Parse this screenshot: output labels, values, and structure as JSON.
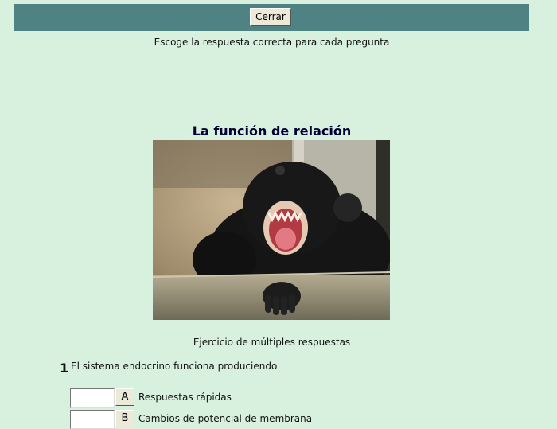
{
  "header": {
    "close_label": "Cerrar"
  },
  "instructions": "Escoge la respuesta correcta para cada pregunta",
  "exercise": {
    "title": "La función de relación",
    "caption": "Ejercicio de múltiples respuestas"
  },
  "question": {
    "number": "1",
    "text": "El sistema endocrino funciona produciendo",
    "answers": [
      {
        "letter": "A",
        "text": "Respuestas rápidas",
        "value": ""
      },
      {
        "letter": "B",
        "text": "Cambios de potencial de membrana",
        "value": ""
      }
    ]
  }
}
